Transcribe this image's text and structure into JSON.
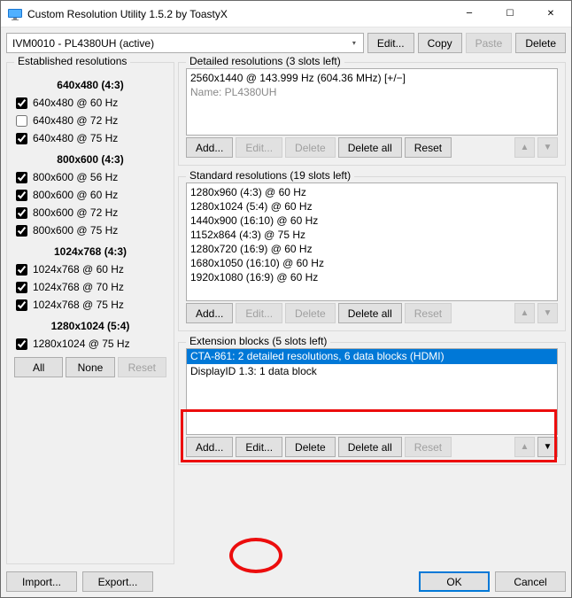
{
  "window": {
    "title": "Custom Resolution Utility 1.5.2 by ToastyX"
  },
  "toolbar": {
    "display_combo": "IVM0010 - PL4380UH (active)",
    "edit": "Edit...",
    "copy": "Copy",
    "paste": "Paste",
    "delete": "Delete"
  },
  "established": {
    "legend": "Established resolutions",
    "groups": [
      {
        "header": "640x480 (4:3)",
        "items": [
          {
            "label": "640x480 @ 60 Hz",
            "checked": true
          },
          {
            "label": "640x480 @ 72 Hz",
            "checked": false
          },
          {
            "label": "640x480 @ 75 Hz",
            "checked": true
          }
        ]
      },
      {
        "header": "800x600 (4:3)",
        "items": [
          {
            "label": "800x600 @ 56 Hz",
            "checked": true
          },
          {
            "label": "800x600 @ 60 Hz",
            "checked": true
          },
          {
            "label": "800x600 @ 72 Hz",
            "checked": true
          },
          {
            "label": "800x600 @ 75 Hz",
            "checked": true
          }
        ]
      },
      {
        "header": "1024x768 (4:3)",
        "items": [
          {
            "label": "1024x768 @ 60 Hz",
            "checked": true
          },
          {
            "label": "1024x768 @ 70 Hz",
            "checked": true
          },
          {
            "label": "1024x768 @ 75 Hz",
            "checked": true
          }
        ]
      },
      {
        "header": "1280x1024 (5:4)",
        "items": [
          {
            "label": "1280x1024 @ 75 Hz",
            "checked": true
          }
        ]
      }
    ],
    "all": "All",
    "none": "None",
    "reset": "Reset"
  },
  "detailed": {
    "legend": "Detailed resolutions (3 slots left)",
    "lines": [
      "2560x1440 @ 143.999 Hz (604.36 MHz) [+/−]",
      "Name: PL4380UH"
    ],
    "add": "Add...",
    "edit": "Edit...",
    "delete": "Delete",
    "deleteall": "Delete all",
    "reset": "Reset"
  },
  "standard": {
    "legend": "Standard resolutions (19 slots left)",
    "lines": [
      "1280x960 (4:3) @ 60 Hz",
      "1280x1024 (5:4) @ 60 Hz",
      "1440x900 (16:10) @ 60 Hz",
      "1152x864 (4:3) @ 75 Hz",
      "1280x720 (16:9) @ 60 Hz",
      "1680x1050 (16:10) @ 60 Hz",
      "1920x1080 (16:9) @ 60 Hz"
    ],
    "add": "Add...",
    "edit": "Edit...",
    "delete": "Delete",
    "deleteall": "Delete all",
    "reset": "Reset"
  },
  "ext": {
    "legend": "Extension blocks (5 slots left)",
    "rows": [
      {
        "text": "CTA-861: 2 detailed resolutions, 6 data blocks (HDMI)",
        "selected": true
      },
      {
        "text": "DisplayID 1.3: 1 data block",
        "selected": false
      }
    ],
    "add": "Add...",
    "edit": "Edit...",
    "delete": "Delete",
    "deleteall": "Delete all",
    "reset": "Reset"
  },
  "footer": {
    "import": "Import...",
    "export": "Export...",
    "ok": "OK",
    "cancel": "Cancel"
  }
}
